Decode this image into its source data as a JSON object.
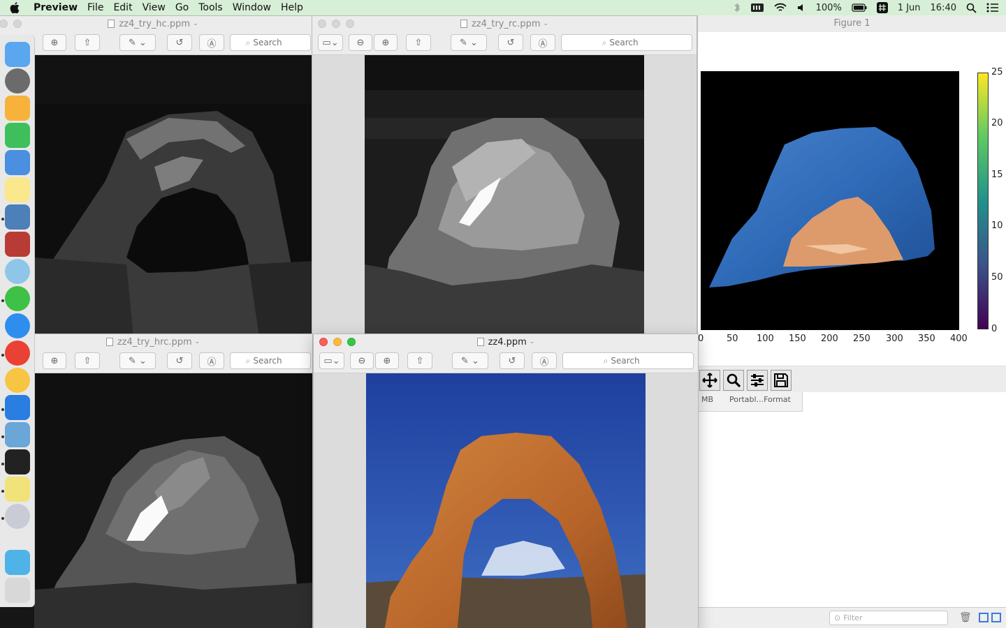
{
  "menubar": {
    "app_name": "Preview",
    "menus": [
      "File",
      "Edit",
      "View",
      "Go",
      "Tools",
      "Window",
      "Help"
    ],
    "battery": "100%",
    "date": "1 Jun",
    "time": "16:40"
  },
  "windows": {
    "hc": {
      "title": "zz4_try_hc.ppm",
      "search_placeholder": "Search"
    },
    "rc": {
      "title": "zz4_try_rc.ppm",
      "search_placeholder": "Search"
    },
    "hrc": {
      "title": "zz4_try_hrc.ppm",
      "search_placeholder": "Search"
    },
    "orig": {
      "title": "zz4.ppm",
      "search_placeholder": "Search"
    }
  },
  "figure": {
    "title": "Figure 1",
    "x_ticks": [
      "0",
      "50",
      "100",
      "150",
      "200",
      "250",
      "300",
      "350",
      "400"
    ],
    "colorbar_ticks": [
      "25",
      "20",
      "15",
      "10",
      "50",
      "0"
    ],
    "colorbar_colors": [
      "#fde725",
      "#5ec962",
      "#21918c",
      "#3b528b",
      "#440154"
    ]
  },
  "finder": {
    "row1_size": "MB",
    "row1_kind": "Portabl...Format",
    "filter_placeholder": "Filter"
  },
  "icons": {
    "zoom_out": "zoom-out-icon",
    "zoom_in": "zoom-in-icon",
    "share": "share-icon",
    "markup": "markup-icon",
    "rotate": "rotate-icon",
    "annotate": "annotate-icon",
    "sidebar": "sidebar-icon"
  }
}
